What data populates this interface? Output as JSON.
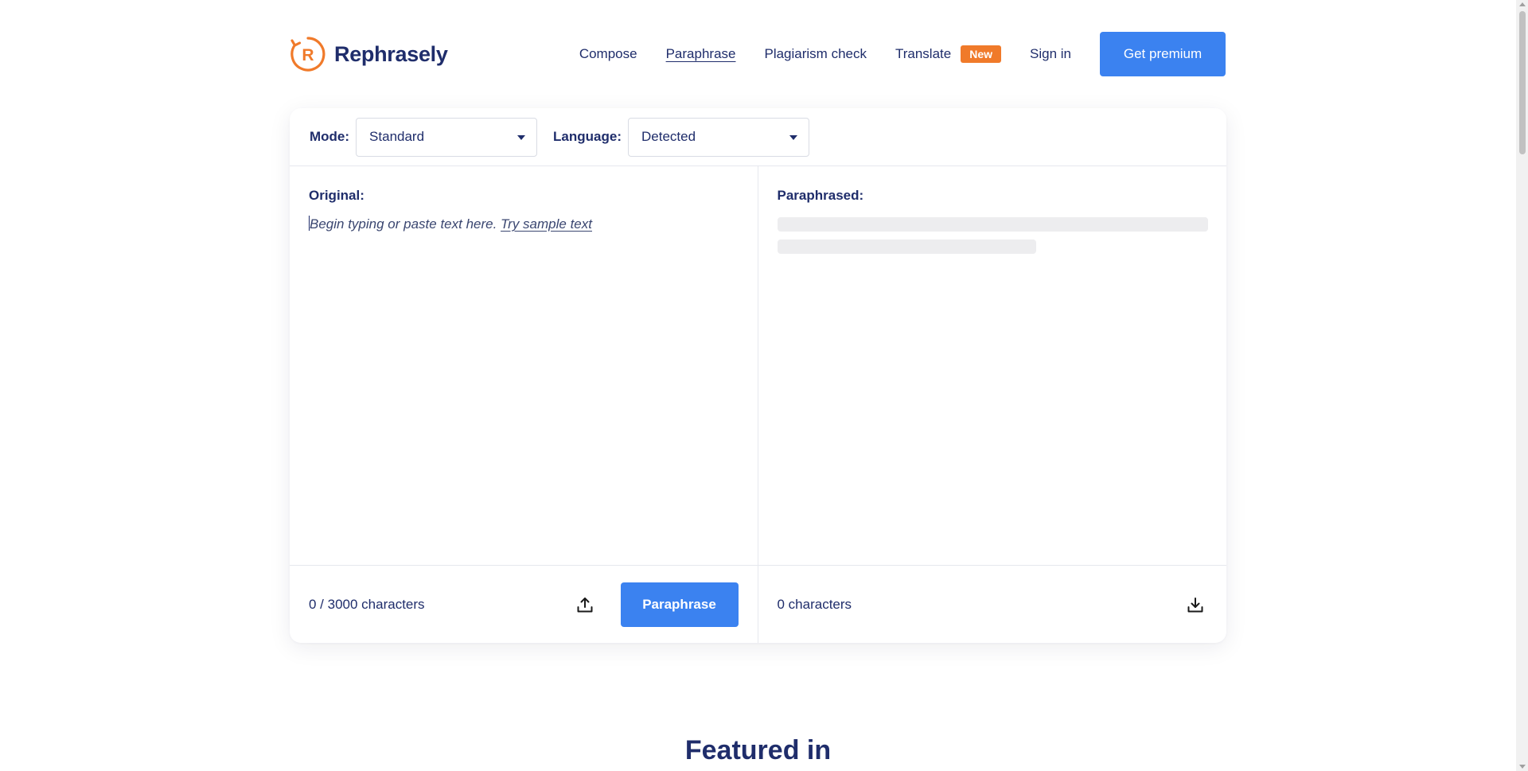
{
  "header": {
    "brand": "Rephrasely",
    "logo_letter": "R",
    "nav": [
      {
        "label": "Compose"
      },
      {
        "label": "Paraphrase",
        "active": true
      },
      {
        "label": "Plagiarism check"
      },
      {
        "label": "Translate",
        "badge": "New"
      }
    ],
    "signin_label": "Sign in",
    "premium_label": "Get premium"
  },
  "toolbar": {
    "mode_label": "Mode:",
    "mode_value": "Standard",
    "language_label": "Language:",
    "language_value": "Detected"
  },
  "original": {
    "label": "Original:",
    "placeholder": "Begin typing or paste text here.",
    "sample_link": "Try sample text",
    "count": "0 / 3000 characters",
    "upload_icon": "upload-icon",
    "paraphrase_label": "Paraphrase"
  },
  "paraphrased": {
    "label": "Paraphrased:",
    "count": "0 characters",
    "download_icon": "download-icon"
  },
  "featured_title": "Featured in",
  "colors": {
    "brand_orange": "#f07a2a",
    "primary_blue": "#3b82f0",
    "navy_text": "#1f2d6b"
  }
}
